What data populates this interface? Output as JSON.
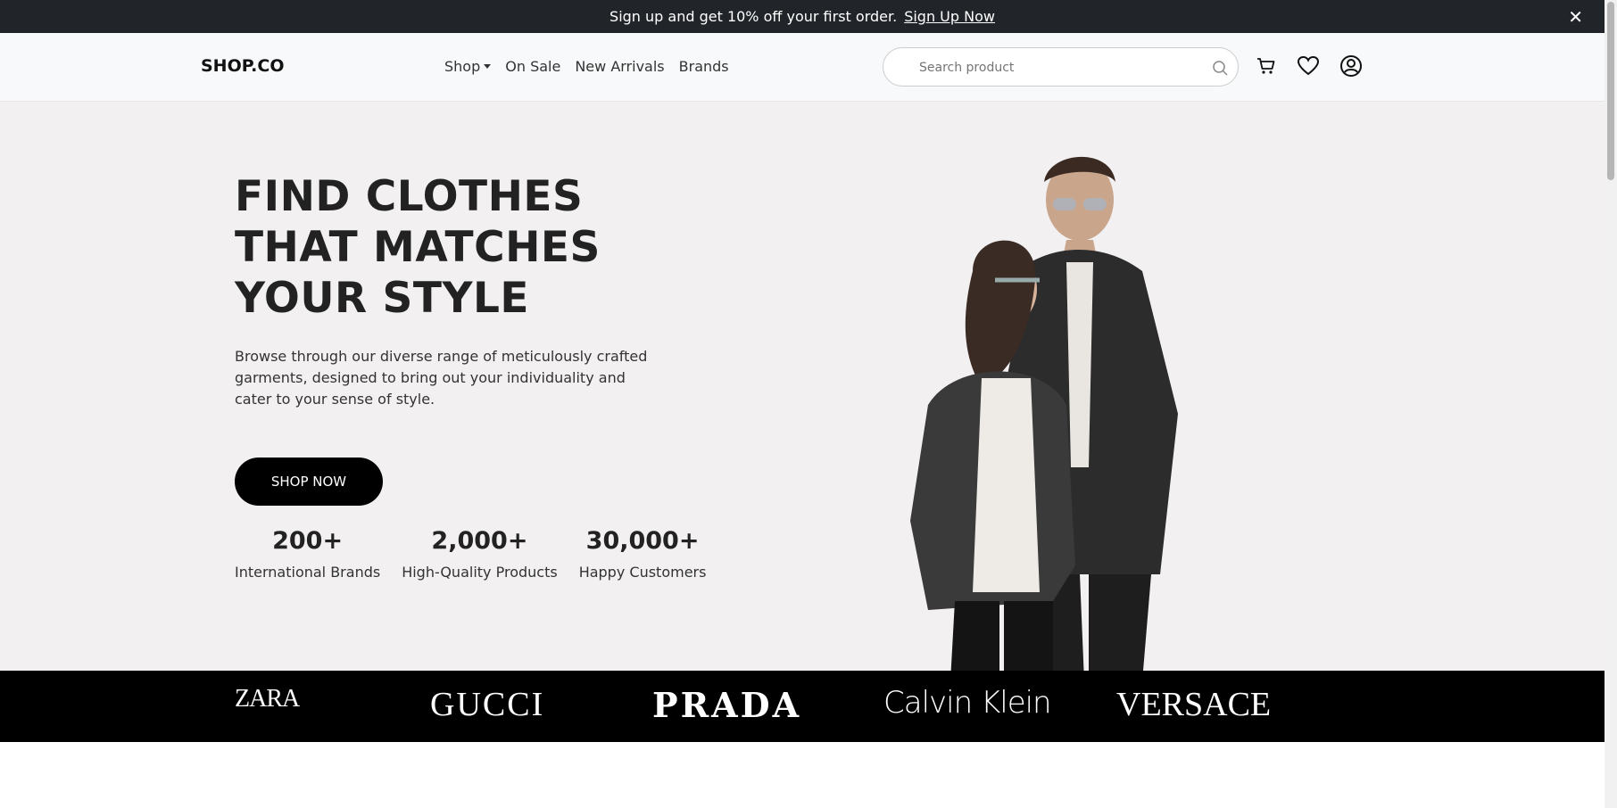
{
  "announcement": {
    "text": "Sign up and get 10% off your first order.",
    "cta": "Sign Up Now",
    "close": "✕"
  },
  "nav": {
    "logo": "SHOP.CO",
    "menu": [
      "Shop",
      "On Sale",
      "New Arrivals",
      "Brands"
    ],
    "search_placeholder": "Search product"
  },
  "hero": {
    "title_lines": [
      "FIND CLOTHES",
      "THAT MATCHES",
      "YOUR STYLE"
    ],
    "description": "Browse through our diverse range of meticulously crafted garments, designed to bring out your individuality and cater to your sense of style.",
    "button": "SHOP NOW",
    "stats": [
      {
        "value": "200+",
        "label": "International Brands"
      },
      {
        "value": "2,000+",
        "label": "High-Quality Products"
      },
      {
        "value": "30,000+",
        "label": "Happy Customers"
      }
    ]
  },
  "brands": [
    "ZARA",
    "GUCCI",
    "PRADA",
    "Calvin Klein",
    "VERSACE"
  ],
  "colors": {
    "topbar_bg": "#212529",
    "hero_bg": "#f2f0f1",
    "brand_strip_bg": "#000000"
  },
  "icons": [
    "search-icon",
    "cart-icon",
    "heart-icon",
    "user-icon",
    "close-icon"
  ]
}
